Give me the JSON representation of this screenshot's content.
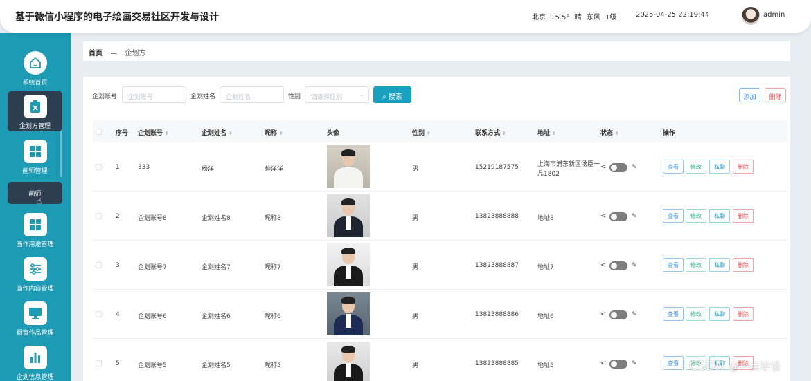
{
  "header": {
    "title": "基于微信小程序的电子绘画交易社区开发与设计",
    "weather": {
      "city": "北京",
      "temp": "15.5°",
      "condition": "晴",
      "wind": "东风",
      "level": "1级"
    },
    "datetime": "2025-04-25 22:19:44",
    "username": "admin"
  },
  "sidebar": {
    "items": [
      {
        "label": "系统首页",
        "icon": "home-icon"
      },
      {
        "label": "企划方管理",
        "icon": "clipboard-icon"
      },
      {
        "label": "画师管理",
        "icon": "grid-icon"
      },
      {
        "label": "画作用途管理",
        "icon": "grid-icon"
      },
      {
        "label": "画作内容管理",
        "icon": "sliders-icon"
      },
      {
        "label": "橱窗作品管理",
        "icon": "monitor-icon"
      },
      {
        "label": "企划信息管理",
        "icon": "bar-chart-icon"
      }
    ],
    "submenu_label": "画师"
  },
  "breadcrumb": {
    "home": "首页",
    "separator": "—",
    "current": "企划方"
  },
  "filter": {
    "account_label": "企划账号",
    "account_placeholder": "企划账号",
    "name_label": "企划姓名",
    "name_placeholder": "企划姓名",
    "gender_label": "性别",
    "gender_placeholder": "请选择性别",
    "search_label": "搜索",
    "add_label": "添加",
    "delete_label": "删除"
  },
  "table": {
    "columns": [
      "序号",
      "企划账号",
      "企划姓名",
      "昵称",
      "头像",
      "性别",
      "联系方式",
      "地址",
      "状态",
      "操作"
    ],
    "rows": [
      {
        "index": "1",
        "account": "333",
        "name": "杨洋",
        "nickname": "帅洋洋",
        "gender": "男",
        "phone": "15219187575",
        "address_line1": "上海市浦东新区汤臣一",
        "address_line2": "品1802"
      },
      {
        "index": "2",
        "account": "企划账号8",
        "name": "企划姓名8",
        "nickname": "昵称8",
        "gender": "男",
        "phone": "13823888888",
        "address_line1": "地址8",
        "address_line2": ""
      },
      {
        "index": "3",
        "account": "企划账号7",
        "name": "企划姓名7",
        "nickname": "昵称7",
        "gender": "男",
        "phone": "13823888887",
        "address_line1": "地址7",
        "address_line2": ""
      },
      {
        "index": "4",
        "account": "企划账号6",
        "name": "企划姓名6",
        "nickname": "昵称6",
        "gender": "男",
        "phone": "13823888886",
        "address_line1": "地址6",
        "address_line2": ""
      },
      {
        "index": "5",
        "account": "企划账号5",
        "name": "企划姓名5",
        "nickname": "昵称5",
        "gender": "男",
        "phone": "13823888885",
        "address_line1": "地址5",
        "address_line2": ""
      }
    ],
    "actions": {
      "view": "查看",
      "edit": "修改",
      "message": "私聊",
      "delete": "删除"
    }
  },
  "watermark": {
    "brand": "CSDN",
    "author": "@一点毕设"
  },
  "colors": {
    "sidebar": "#1d9ab4",
    "active_nav": "#2c3e50",
    "accent": "#1aa0bf"
  }
}
